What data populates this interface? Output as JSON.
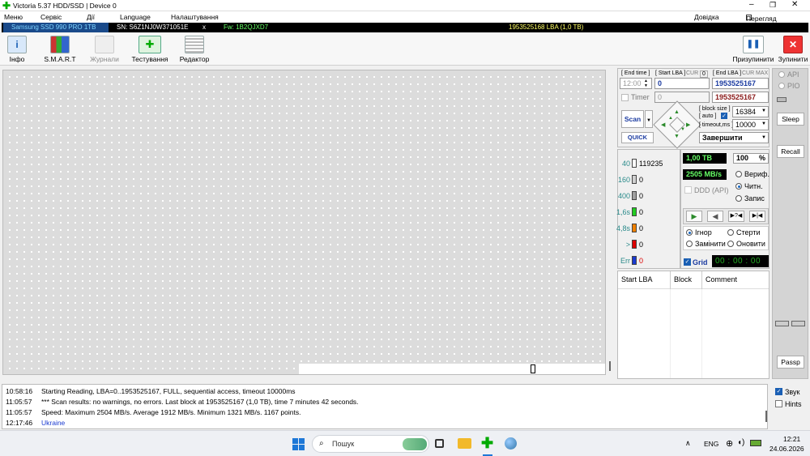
{
  "app": {
    "title": "Victoria 5.37 HDD/SSD | Device 0"
  },
  "menu": {
    "items": [
      "Меню",
      "Сервіс",
      "Дії",
      "Language",
      "Налаштування"
    ],
    "help": "Довідка",
    "clipboard": "Перегляд буфера"
  },
  "device": {
    "model": "Samsung SSD 990 PRO 1TB",
    "serial": "SN: S6Z1NJ0W371051E",
    "x": "x",
    "fw": "Fw: 1B2QJXD7",
    "capacity": "1953525168 LBA (1,0 TB)"
  },
  "toolbar": {
    "info": "Інфо",
    "smart": "S.M.A.R.T",
    "logs": "Журнали",
    "testing": "Тестування",
    "editor": "Редактор",
    "pause": "Призупинити",
    "stop": "Зупинити"
  },
  "scan": {
    "end_time_label": "[ End time ]",
    "end_time": "12:00",
    "start_lba_label": "[ Start LBA ]",
    "end_lba_label": "[ End LBA ]",
    "cur": "CUR",
    "zero": "0",
    "max": "MAX",
    "start_lba": "0",
    "end_lba": "1953525167",
    "end_lba2": "1953525167",
    "timer_label": "Timer",
    "timer_value": "0",
    "scan_button": "Scan",
    "quick_button": "QUICK",
    "block_size_label": "[ block size ]",
    "auto_label": "[ auto ]",
    "block_size": "16384",
    "timeout_label": "[ timeout,ms ]",
    "timeout": "10000",
    "finish_option": "Завершити"
  },
  "stats": {
    "rows": [
      {
        "label": "40",
        "count": "119235",
        "color": "#ffffff"
      },
      {
        "label": "160",
        "count": "0",
        "color": "#d0d0d0"
      },
      {
        "label": "400",
        "count": "0",
        "color": "#a0a0a0"
      },
      {
        "label": "1,6s",
        "count": "0",
        "color": "#22cc22"
      },
      {
        "label": "4,8s",
        "count": "0",
        "color": "#f08000"
      },
      {
        "label": ">",
        "count": "0",
        "color": "#dd0000"
      },
      {
        "label": "Err",
        "count": "0",
        "color": "#1a3ad0"
      }
    ],
    "size": "1,00 TB",
    "percent": "100",
    "percent_sign": "%",
    "speed": "2505 MB/s",
    "ddd": "DDD (API)",
    "verify": "Вериф.",
    "read": "Читн.",
    "write": "Запис",
    "ignore": "Ігнор",
    "erase": "Стерти",
    "replace": "Замінити",
    "refresh": "Оновити",
    "grid_label": "Grid",
    "timer": "00 : 00 : 00"
  },
  "table": {
    "headers": [
      "Start LBA",
      "Block",
      "Comment"
    ]
  },
  "side": {
    "api": "API",
    "pio": "PIO",
    "sleep": "Sleep",
    "recall": "Recall",
    "passp": "Passp"
  },
  "log": {
    "rows": [
      {
        "time": "10:58:16",
        "text": "Starting Reading, LBA=0..1953525167, FULL, sequential access, timeout 10000ms",
        "color": "#000000"
      },
      {
        "time": "11:05:57",
        "text": "*** Scan results: no warnings, no errors. Last block at 1953525167 (1,0 TB), time 7 minutes 42 seconds.",
        "color": "#000000"
      },
      {
        "time": "11:05:57",
        "text": "Speed: Maximum 2504 MB/s. Average 1912 MB/s. Minimum 1321 MB/s. 1167 points.",
        "color": "#000000"
      },
      {
        "time": "12:17:46",
        "text": "Ukraine",
        "color": "#1a3ad0"
      }
    ],
    "sound": "Звук",
    "hints": "Hints"
  },
  "taskbar": {
    "search": "Пошук",
    "lang": "ENG",
    "time": "12:21",
    "date": "24.06.2026"
  }
}
